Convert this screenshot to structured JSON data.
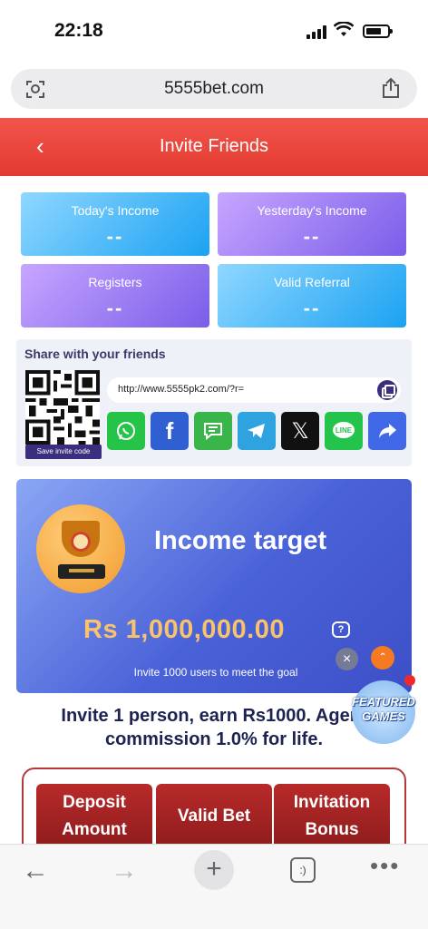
{
  "status_bar": {
    "time": "22:18"
  },
  "browser": {
    "url": "5555bet.com",
    "tabs_label": ":)"
  },
  "header": {
    "title": "Invite Friends"
  },
  "stats": [
    {
      "label": "Today's Income",
      "value": "--"
    },
    {
      "label": "Yesterday's Income",
      "value": "--"
    },
    {
      "label": "Registers",
      "value": "--"
    },
    {
      "label": "Valid Referral",
      "value": "--"
    }
  ],
  "share": {
    "title": "Share with your friends",
    "link": "http://www.5555pk2.com/?r=",
    "save_code_label": "Save invite code",
    "apps": [
      {
        "name": "whatsapp",
        "color": "#25c348"
      },
      {
        "name": "facebook",
        "color": "#2f5fd1"
      },
      {
        "name": "sms",
        "color": "#39b54a"
      },
      {
        "name": "telegram",
        "color": "#2fa2e0"
      },
      {
        "name": "x",
        "color": "#111111"
      },
      {
        "name": "line",
        "color": "#24c44c"
      },
      {
        "name": "share",
        "color": "#4168e6"
      }
    ]
  },
  "income_target": {
    "title": "Income target",
    "amount": "Rs 1,000,000.00",
    "subtitle": "Invite 1000 users to meet the goal"
  },
  "featured": {
    "label": "FEATURED GAMES"
  },
  "invite_text": "Invite 1 person, earn Rs1000. Agent commission 1.0% for life.",
  "bonus_table": {
    "columns": [
      "Deposit Amount",
      "Valid Bet",
      "Invitation Bonus"
    ]
  },
  "colors": {
    "header_red": "#e23a30",
    "accent_gold": "#f8c36b",
    "dark_navy": "#1c2351"
  }
}
